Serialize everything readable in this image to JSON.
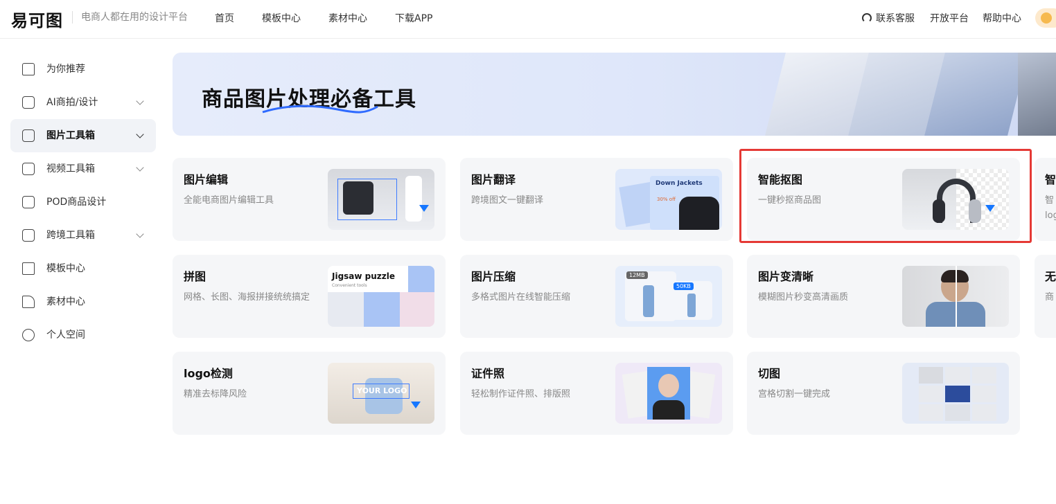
{
  "header": {
    "logo": "易可图",
    "slogan": "电商人都在用的设计平台",
    "nav": [
      "首页",
      "模板中心",
      "素材中心",
      "下载APP"
    ],
    "right": {
      "support": "联系客服",
      "open_platform": "开放平台",
      "help": "帮助中心"
    }
  },
  "sidebar": {
    "items": [
      {
        "label": "为你推荐",
        "icon": "home-icon",
        "expandable": false
      },
      {
        "label": "AI商拍/设计",
        "icon": "ai-icon",
        "expandable": true
      },
      {
        "label": "图片工具箱",
        "icon": "toolbox-icon",
        "expandable": true,
        "active": true
      },
      {
        "label": "视频工具箱",
        "icon": "video-icon",
        "expandable": true
      },
      {
        "label": "POD商品设计",
        "icon": "bag-icon",
        "expandable": false
      },
      {
        "label": "跨境工具箱",
        "icon": "bookmark-icon",
        "expandable": true
      },
      {
        "label": "模板中心",
        "icon": "template-icon",
        "expandable": false
      },
      {
        "label": "素材中心",
        "icon": "material-icon",
        "expandable": false
      },
      {
        "label": "个人空间",
        "icon": "user-icon",
        "expandable": false
      }
    ]
  },
  "banner": {
    "title": "商品图片处理必备工具"
  },
  "tools": [
    {
      "title": "图片编辑",
      "desc": "全能电商图片编辑工具"
    },
    {
      "title": "图片翻译",
      "desc": "跨境图文一键翻译",
      "img_text": "Down Jackets",
      "img_sub": "30% off"
    },
    {
      "title": "智能抠图",
      "desc": "一键秒抠商品图"
    },
    {
      "title": "拼图",
      "desc": "网格、长图、海报拼接统统搞定",
      "img_text": "Jigsaw puzzle",
      "img_sub": "Convenient tools"
    },
    {
      "title": "图片压缩",
      "desc": "多格式图片在线智能压缩",
      "img_before": "12MB",
      "img_after": "50KB"
    },
    {
      "title": "图片变清晰",
      "desc": "模糊图片秒变高清画质"
    },
    {
      "title": "logo检测",
      "desc": "精准去标降风险",
      "img_text": "YOUR LOGO"
    },
    {
      "title": "证件照",
      "desc": "轻松制作证件照、排版照"
    },
    {
      "title": "切图",
      "desc": "宫格切割一键完成"
    }
  ],
  "partial_cards": [
    {
      "title": "智",
      "desc1": "智",
      "desc2": "log"
    },
    {
      "title": "无",
      "desc1": "商"
    }
  ],
  "colors": {
    "accent": "#1677ff",
    "highlight": "#e53935",
    "card_bg": "#f5f6f8",
    "active_bg": "#f1f3f7"
  }
}
